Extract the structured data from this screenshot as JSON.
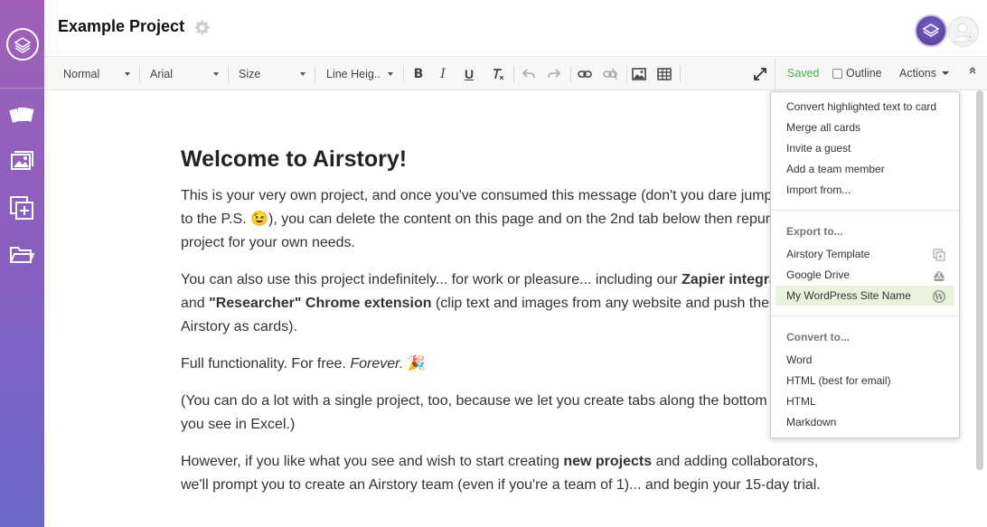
{
  "header": {
    "project_title": "Example Project"
  },
  "toolbar": {
    "style_select": "Normal",
    "font_select": "Arial",
    "size_select": "Size",
    "line_height_select": "Line Heig..",
    "saved_label": "Saved",
    "outline_label": "Outline",
    "actions_label": "Actions"
  },
  "document": {
    "heading": "Welcome to Airstory!",
    "p1": "This is your very own project, and once you've consumed this message (don't you dare jump straight to the P.S. 😉), you can delete the content on this page and on the 2nd tab below then repurpose this project for your own needs.",
    "p2_a": "You can also use this project indefinitely... for work or pleasure... including our ",
    "p2_b": "Zapier integration",
    "p2_c": " and ",
    "p2_d": "\"Researcher\" Chrome extension",
    "p2_e": " (clip text and images from any website and push them into Airstory as cards).",
    "p3_a": "Full functionality. For free. ",
    "p3_b": "Forever.",
    "p3_c": " 🎉",
    "p4": "(You can do a lot with a single project, too, because we let you create tabs along the bottom like what you see in Excel.)",
    "p5_a": "However, if you like what you see and wish to start creating ",
    "p5_b": "new projects",
    "p5_c": " and adding collaborators, we'll prompt you to create an Airstory team (even if you're a team of 1)... and begin your 15-day trial."
  },
  "actions_menu": {
    "items": [
      "Convert highlighted text to card",
      "Merge all cards",
      "Invite a guest",
      "Add a team member",
      "Import from..."
    ],
    "export_heading": "Export to...",
    "export_items": [
      "Airstory Template",
      "Google Drive",
      "My WordPress Site Name"
    ],
    "convert_heading": "Convert to...",
    "convert_items": [
      "Word",
      "HTML (best for email)",
      "HTML",
      "Markdown"
    ]
  },
  "colors": {
    "saved_green": "#4caf50",
    "sidebar_top": "#a060b8",
    "sidebar_bottom": "#6a68c8",
    "highlight": "#e9f2dd"
  }
}
